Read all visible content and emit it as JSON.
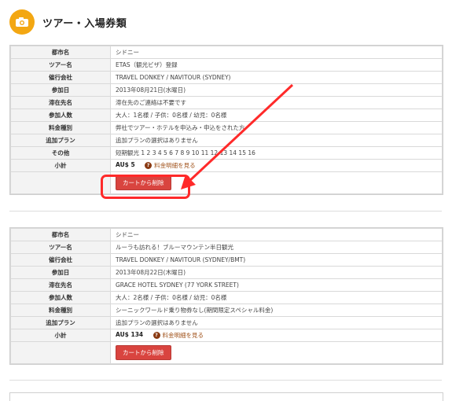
{
  "header": {
    "title": "ツアー・入場券類",
    "icon": "camera-icon",
    "accent": "#f3a712"
  },
  "bookings": [
    {
      "rows": [
        {
          "label": "都市名",
          "value": "シドニー"
        },
        {
          "label": "ツアー名",
          "value": "ETAS（観光ビザ）登録"
        },
        {
          "label": "催行会社",
          "value": "TRAVEL DONKEY / NAVITOUR (SYDNEY)"
        },
        {
          "label": "参加日",
          "value": "2013年08月21日(水曜日)"
        },
        {
          "label": "滞在先名",
          "value": "滞在先のご連絡は不要です"
        },
        {
          "label": "参加人数",
          "value": "大人：1名様 / 子供：0名様 / 幼児：0名様"
        },
        {
          "label": "料金種別",
          "value": "弊社でツアー・ホテルを申込み・申込をされた方"
        },
        {
          "label": "追加プラン",
          "value": "追加プランの選択はありません"
        },
        {
          "label": "その他",
          "value": "短期観光 1 2 3 4 5 6 7 8 9 10 11 12 13 14 15 16"
        }
      ],
      "subtotal_label": "小計",
      "subtotal_value": "AU$ 5",
      "fee_link": "料金明細を見る",
      "remove_button": "カートから削除"
    },
    {
      "rows": [
        {
          "label": "都市名",
          "value": "シドニー"
        },
        {
          "label": "ツアー名",
          "value": "ルーラも訪れる！ブルーマウンテン半日観光"
        },
        {
          "label": "催行会社",
          "value": "TRAVEL DONKEY / NAVITOUR (SYDNEY/BMT)"
        },
        {
          "label": "参加日",
          "value": "2013年08月22日(木曜日)"
        },
        {
          "label": "滞在先名",
          "value": "GRACE HOTEL SYDNEY (77 YORK STREET)"
        },
        {
          "label": "参加人数",
          "value": "大人：2名様 / 子供：0名様 / 幼児：0名様"
        },
        {
          "label": "料金種別",
          "value": "シーニックワールド乗り物券なし(期間限定スペシャル料金)"
        },
        {
          "label": "追加プラン",
          "value": "追加プランの選択はありません"
        }
      ],
      "subtotal_label": "小計",
      "subtotal_value": "AU$ 134",
      "fee_link": "料金明細を見る",
      "remove_button": "カートから削除"
    }
  ],
  "colors": {
    "button": "#d9443f",
    "highlight": "#ff2a2a",
    "link": "#a0521a"
  }
}
